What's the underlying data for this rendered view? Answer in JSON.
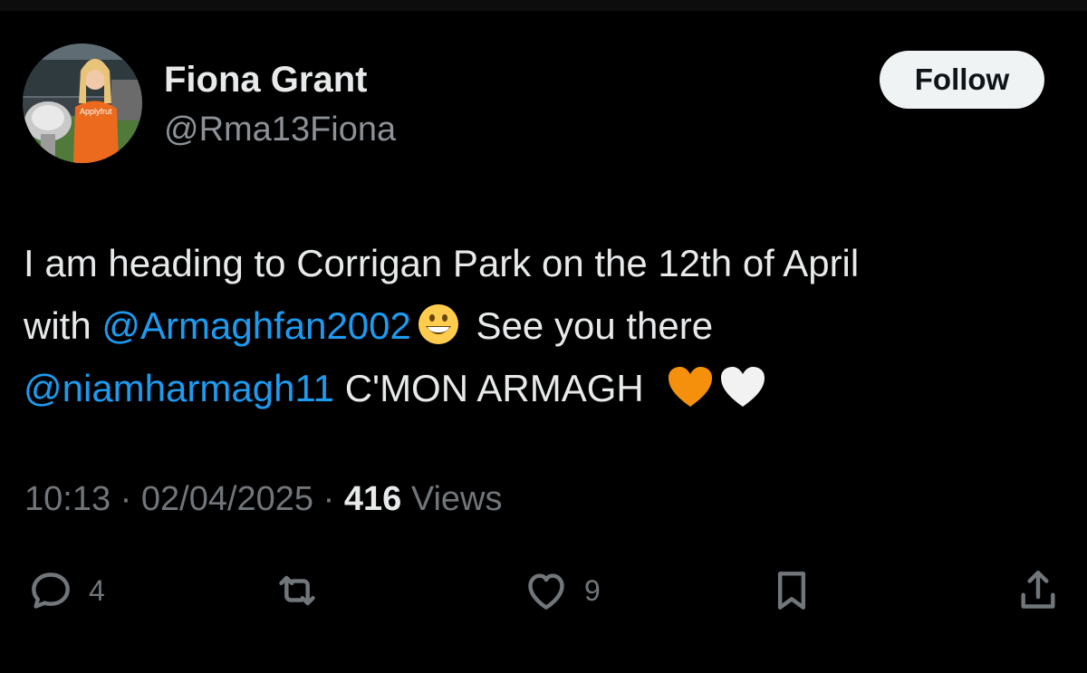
{
  "author": {
    "name": "Fiona Grant",
    "handle": "@Rma13Fiona",
    "jersey_text": "Applyfrut"
  },
  "follow_label": "Follow",
  "tweet": {
    "line1": "I am heading to Corrigan Park on the 12th of April",
    "line2_pre": "with ",
    "mention1": "@Armaghfan2002",
    "line2_post": " See you there",
    "mention2": "@niamharmagh11",
    "line3_post": " C'MON ARMAGH"
  },
  "meta": {
    "time": "10:13",
    "date": "02/04/2025",
    "views_count": "416",
    "views_label": "Views"
  },
  "actions": {
    "replies": "4",
    "likes": "9"
  },
  "colors": {
    "background": "#000000",
    "text": "#e7e9ea",
    "secondary": "#71767b",
    "link": "#1d9bf0",
    "follow_bg": "#eff3f4"
  }
}
